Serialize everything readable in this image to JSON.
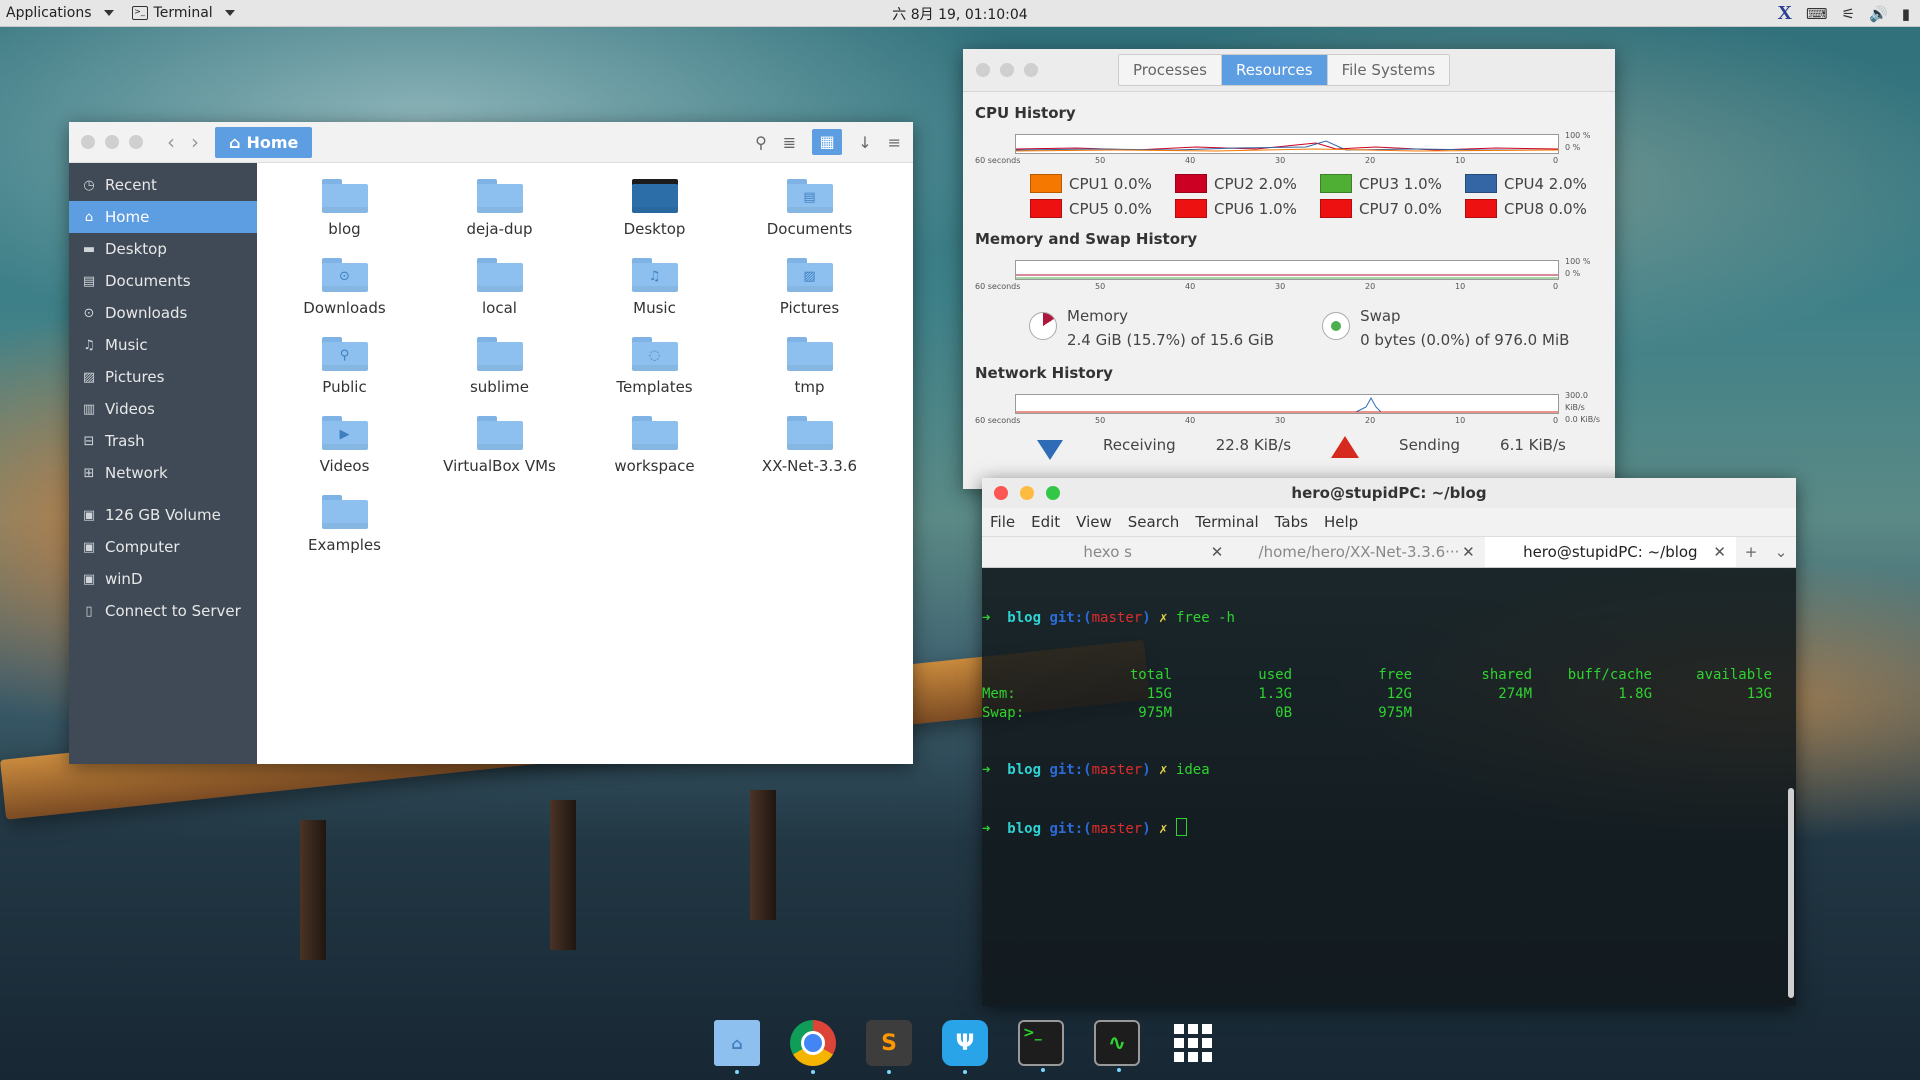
{
  "top_panel": {
    "applications": "Applications",
    "terminal": "Terminal",
    "clock": "六 8月 19, 01:10:04"
  },
  "file_manager": {
    "path": "Home",
    "sidebar": [
      {
        "label": "Recent",
        "icon": "clock-icon"
      },
      {
        "label": "Home",
        "icon": "home-icon",
        "active": true
      },
      {
        "label": "Desktop",
        "icon": "desktop-icon"
      },
      {
        "label": "Documents",
        "icon": "document-icon"
      },
      {
        "label": "Downloads",
        "icon": "download-icon"
      },
      {
        "label": "Music",
        "icon": "music-icon"
      },
      {
        "label": "Pictures",
        "icon": "picture-icon"
      },
      {
        "label": "Videos",
        "icon": "video-icon"
      },
      {
        "label": "Trash",
        "icon": "trash-icon"
      },
      {
        "label": "Network",
        "icon": "network-icon"
      },
      {
        "label": "126 GB Volume",
        "icon": "drive-icon"
      },
      {
        "label": "Computer",
        "icon": "computer-icon"
      },
      {
        "label": "winD",
        "icon": "drive-icon"
      },
      {
        "label": "Connect to Server",
        "icon": "server-icon"
      }
    ],
    "files": [
      "blog",
      "deja-dup",
      "Desktop",
      "Documents",
      "Downloads",
      "local",
      "Music",
      "Pictures",
      "Public",
      "sublime",
      "Templates",
      "tmp",
      "Videos",
      "VirtualBox VMs",
      "workspace",
      "XX-Net-3.3.6",
      "Examples"
    ]
  },
  "system_monitor": {
    "tabs": [
      "Processes",
      "Resources",
      "File Systems"
    ],
    "cpu_title": "CPU History",
    "axis": [
      "60 seconds",
      "50",
      "40",
      "30",
      "20",
      "10",
      "0"
    ],
    "cpu_pct": [
      "100 %",
      "0 %"
    ],
    "cpus": [
      {
        "label": "CPU1 0.0%",
        "color": "#f57900"
      },
      {
        "label": "CPU2 2.0%",
        "color": "#cc0022"
      },
      {
        "label": "CPU3 1.0%",
        "color": "#4fae34"
      },
      {
        "label": "CPU4 2.0%",
        "color": "#3465a4"
      },
      {
        "label": "CPU5 0.0%",
        "color": "#ee1111"
      },
      {
        "label": "CPU6 1.0%",
        "color": "#ee1111"
      },
      {
        "label": "CPU7 0.0%",
        "color": "#ee1111"
      },
      {
        "label": "CPU8 0.0%",
        "color": "#ee1111"
      }
    ],
    "mem_title": "Memory and Swap History",
    "mem_pct": [
      "100 %",
      "0 %"
    ],
    "memory_label": "Memory",
    "memory_value": "2.4 GiB (15.7%) of 15.6 GiB",
    "swap_label": "Swap",
    "swap_value": "0 bytes (0.0%) of 976.0 MiB",
    "net_title": "Network History",
    "net_scale": [
      "300.0 KiB/s",
      "0.0 KiB/s"
    ],
    "receiving_label": "Receiving",
    "receiving_value": "22.8 KiB/s",
    "sending_label": "Sending",
    "sending_value": "6.1 KiB/s"
  },
  "terminal": {
    "title": "hero@stupidPC: ~/blog",
    "menu": [
      "File",
      "Edit",
      "View",
      "Search",
      "Terminal",
      "Tabs",
      "Help"
    ],
    "tabs": [
      "hexo s",
      "/home/hero/XX-Net-3.3.6···",
      "hero@stupidPC: ~/blog"
    ],
    "prompt_arrow": "➜",
    "prompt_dir": "blog",
    "prompt_git": "git:(",
    "prompt_branch": "master",
    "prompt_close": ")",
    "prompt_x": "✗",
    "cmd1": "free -h",
    "cmd2": "idea",
    "free_header": [
      "",
      "total",
      "used",
      "free",
      "shared",
      "buff/cache",
      "available"
    ],
    "free_mem": [
      "Mem:",
      "15G",
      "1.3G",
      "12G",
      "274M",
      "1.8G",
      "13G"
    ],
    "free_swap": [
      "Swap:",
      "975M",
      "0B",
      "975M",
      "",
      "",
      ""
    ]
  },
  "dock": [
    "files",
    "chrome",
    "sublime",
    "telegram",
    "terminal",
    "system-monitor",
    "app-grid"
  ]
}
